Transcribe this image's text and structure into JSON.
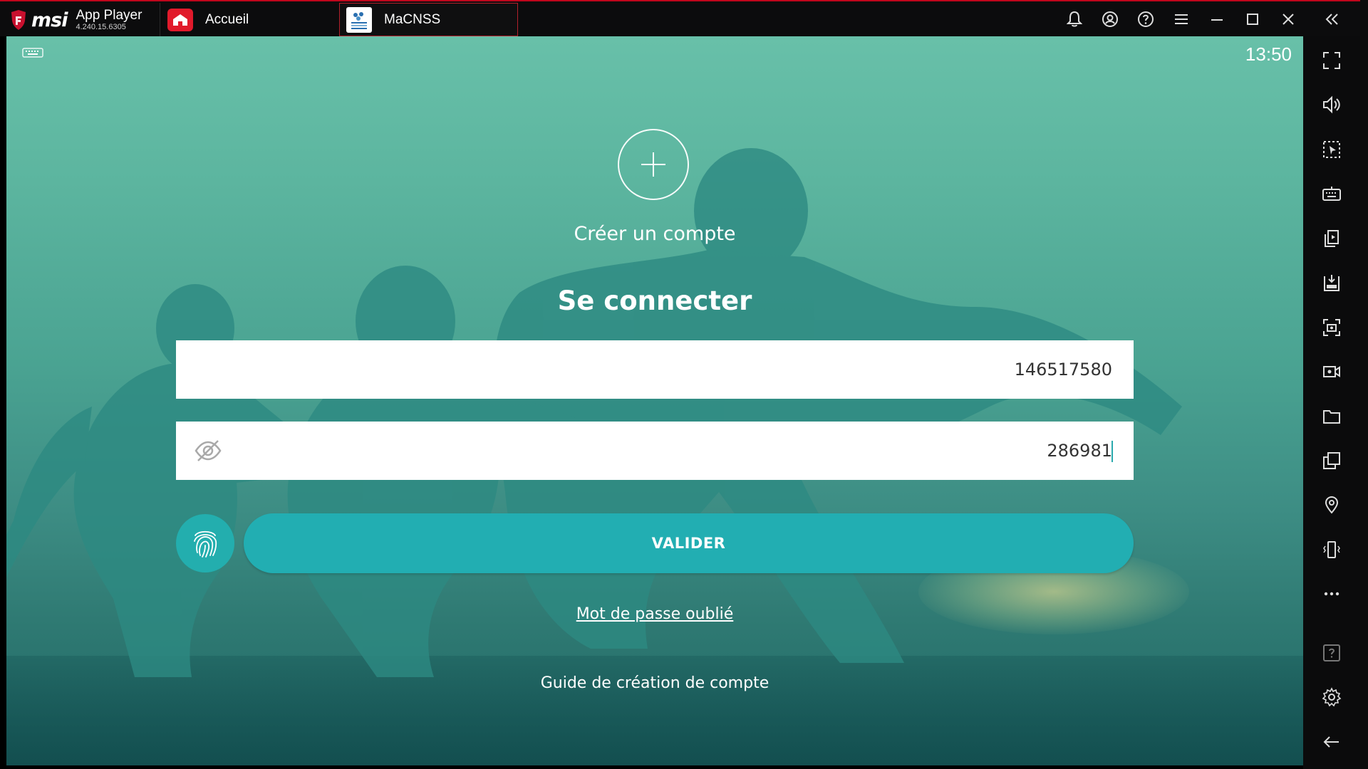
{
  "titlebar": {
    "brand": "msi",
    "app_name": "App Player",
    "version": "4.240.15.6305",
    "tabs": [
      {
        "label": "Accueil",
        "icon": "home-icon",
        "active": false
      },
      {
        "label": "MaCNSS",
        "icon": "macnss-app-icon",
        "active": true
      }
    ],
    "icons": [
      "bell-icon",
      "account-icon",
      "help-icon",
      "menu-icon",
      "minimize-icon",
      "maximize-icon",
      "close-icon",
      "collapse-sidebar-icon"
    ]
  },
  "statusbar": {
    "keyboard_icon": "keyboard-icon",
    "time": "13:50"
  },
  "login": {
    "create_account_label": "Créer un compte",
    "title": "Se connecter",
    "username_value": "146517580",
    "password_value": "286981",
    "validate_label": "VALIDER",
    "forgot_password_label": "Mot de passe oublié",
    "guide_label": "Guide de création de compte"
  },
  "sidebar": {
    "icons": [
      "fullscreen-icon",
      "volume-icon",
      "pointer-select-icon",
      "keyboard-controls-icon",
      "install-app-icon",
      "apk-install-icon",
      "screenshot-icon",
      "record-icon",
      "folder-icon",
      "multi-instance-icon",
      "location-icon",
      "shake-icon",
      "more-icon",
      "help-icon",
      "settings-icon",
      "back-icon"
    ]
  },
  "colors": {
    "accent": "#22aeb2",
    "titlebar_bg": "#0c0c0d",
    "brand_red": "#c0061c"
  }
}
